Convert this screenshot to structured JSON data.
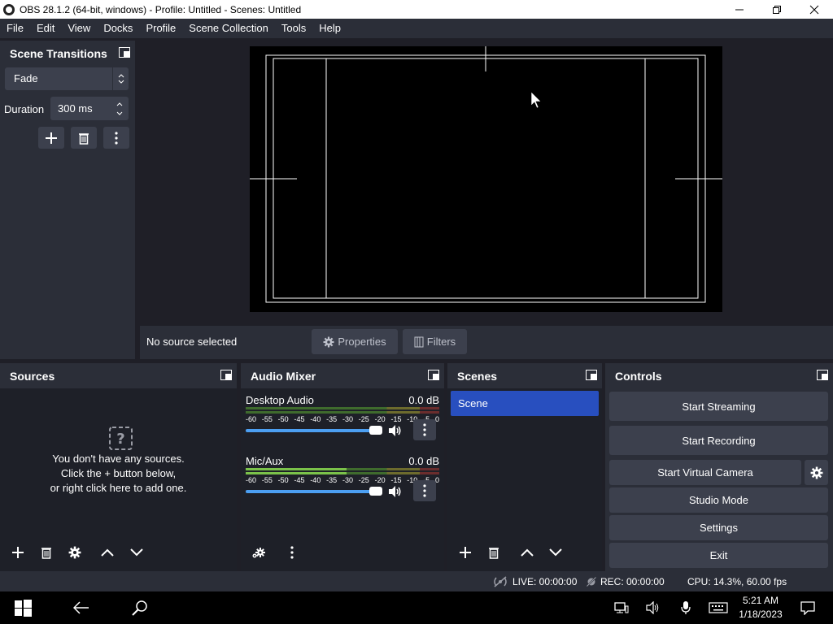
{
  "window": {
    "title": "OBS 28.1.2 (64-bit, windows) - Profile: Untitled - Scenes: Untitled"
  },
  "menu": [
    "File",
    "Edit",
    "View",
    "Docks",
    "Profile",
    "Scene Collection",
    "Tools",
    "Help"
  ],
  "scene_transitions": {
    "title": "Scene Transitions",
    "transition": "Fade",
    "duration_label": "Duration",
    "duration_value": "300 ms"
  },
  "source_bar": {
    "no_source": "No source selected",
    "properties": "Properties",
    "filters": "Filters"
  },
  "sources": {
    "title": "Sources",
    "empty_line1": "You don't have any sources.",
    "empty_line2": "Click the + button below,",
    "empty_line3": "or right click here to add one."
  },
  "audio_mixer": {
    "title": "Audio Mixer",
    "channels": [
      {
        "name": "Desktop Audio",
        "db": "0.0 dB",
        "volume": 1.0
      },
      {
        "name": "Mic/Aux",
        "db": "0.0 dB",
        "volume": 1.0
      }
    ],
    "scale": [
      "-60",
      "-55",
      "-50",
      "-45",
      "-40",
      "-35",
      "-30",
      "-25",
      "-20",
      "-15",
      "-10",
      "-5",
      "0"
    ]
  },
  "scenes": {
    "title": "Scenes",
    "items": [
      "Scene"
    ]
  },
  "controls": {
    "title": "Controls",
    "start_streaming": "Start Streaming",
    "start_recording": "Start Recording",
    "start_virtual_camera": "Start Virtual Camera",
    "studio_mode": "Studio Mode",
    "settings": "Settings",
    "exit": "Exit"
  },
  "status": {
    "live": "LIVE: 00:00:00",
    "rec": "REC: 00:00:00",
    "cpu": "CPU: 14.3%, 60.00 fps"
  },
  "taskbar": {
    "time": "5:21 AM",
    "date": "1/18/2023"
  },
  "colors": {
    "panel": "#2b2e38",
    "background": "#1f1f27",
    "button": "#3c404d",
    "selection": "#284fbf",
    "slider": "#4c9ff2"
  }
}
